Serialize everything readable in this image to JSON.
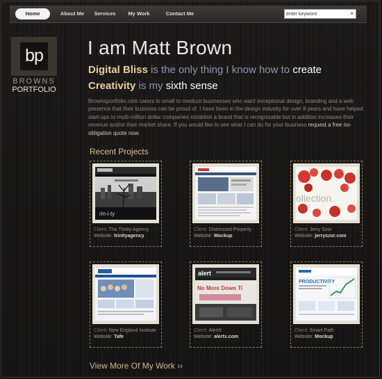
{
  "nav": {
    "items": [
      "Home",
      "About Me",
      "Services",
      "My Work",
      "Contact Me"
    ],
    "search_value": "enter keyword",
    "search_clear": "×"
  },
  "logo": {
    "mark": "bp",
    "line1": "BROWNS",
    "line2": "PORTFOLIO"
  },
  "hero": {
    "title": "I am Matt Brown",
    "tagline1": {
      "em": "Digital Bliss",
      "mid": " is the only thing I know how to ",
      "w": "create"
    },
    "tagline2": {
      "em": "Creativity",
      "mid": " is my ",
      "w": "sixth sense"
    },
    "intro": "Brownsportfolio.com caters to small to medium businesses who want exceptional design, branding and a web presence that their business can be proud of. I have been in the design industry for over 8 years and have helped start-ups to multi-million dollar companies establish a brand that is recognizable but in addition increases their revenue and/or their market share. If you would like to see what I can do for your business ",
    "intro_link": "request a free no-obligation quote now."
  },
  "projects": {
    "heading": "Recent Projects",
    "client_label": "Client:",
    "website_label": "Website:",
    "items": [
      {
        "client": "The Trinity Agency",
        "website": "trinityagency"
      },
      {
        "client": "Distressed Property",
        "website": "Mockup"
      },
      {
        "client": "Jerry Szor",
        "website": "jerryszor.com"
      },
      {
        "client": "New England Institute",
        "website": "Tafe"
      },
      {
        "client": "AlertX",
        "website": "alertx.com"
      },
      {
        "client": "Smart Path",
        "website": "Mockup"
      }
    ],
    "shots": {
      "trinity_text": "rin-i-ty",
      "collection_text": "ollection",
      "alert_logo": "alert",
      "alert_headline": "No More Down Ti",
      "productivity_text": "PRODUCTIVITY"
    }
  },
  "view_more": "View More Of My Work ››",
  "colors": {
    "accent_gold": "#e6cf9a",
    "tagline_blue": "#8a94b0",
    "dashed_border": "#8d7e55"
  }
}
